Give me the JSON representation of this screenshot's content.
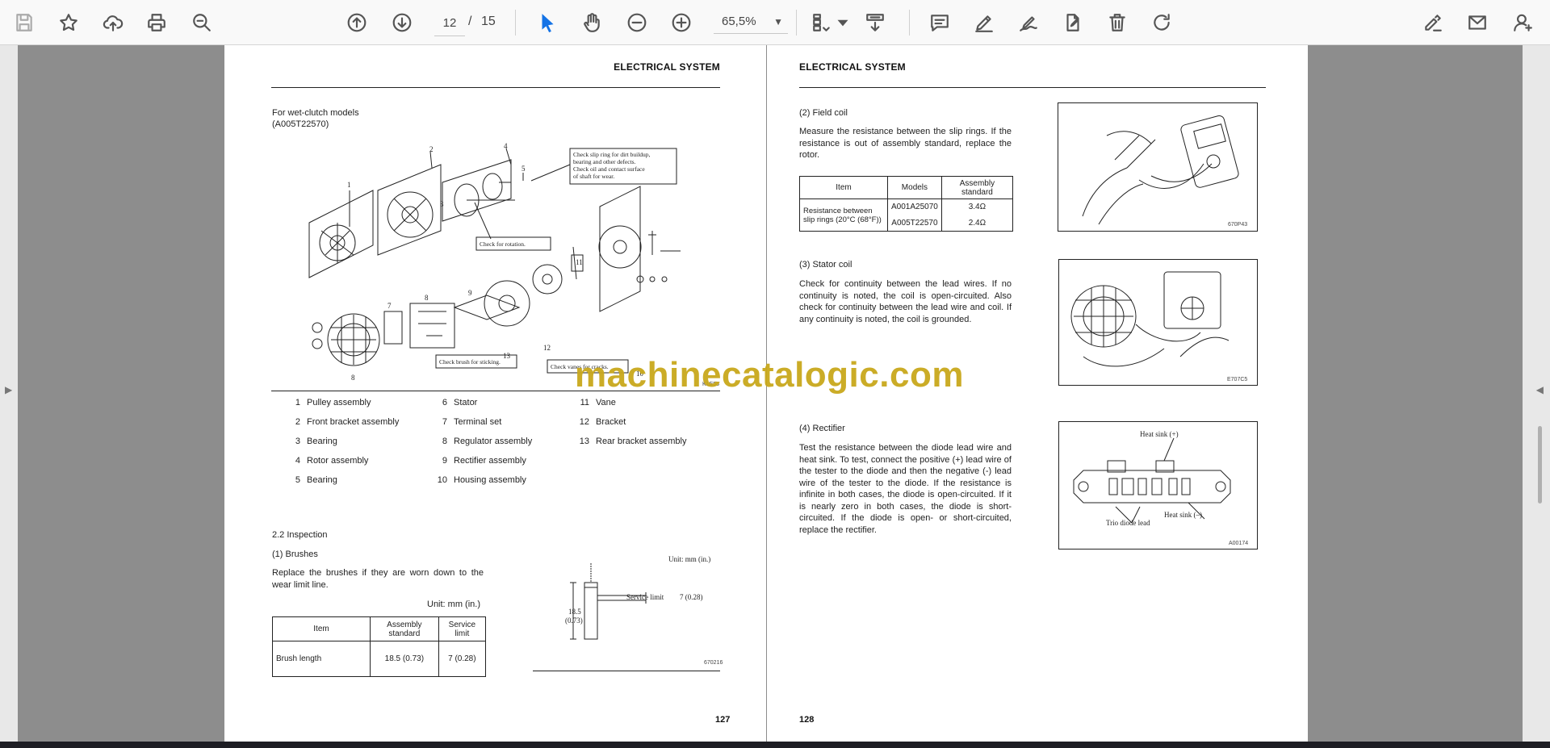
{
  "toolbar": {
    "page_current": "12",
    "page_separator": "/",
    "page_total": "15",
    "zoom": "65,5%",
    "icons": [
      "save-icon",
      "bookmark-star-icon",
      "upload-cloud-icon",
      "print-icon",
      "search-zoom-icon",
      "page-up-icon",
      "page-down-icon",
      "select-cursor-icon",
      "hand-pan-icon",
      "zoom-out-icon",
      "zoom-in-icon",
      "page-layout-icon",
      "scroll-mode-icon",
      "comment-icon",
      "highlight-pen-icon",
      "draw-sign-icon",
      "edit-pdf-icon",
      "delete-icon",
      "rotate-icon",
      "fill-sign-icon",
      "email-icon",
      "add-user-icon"
    ]
  },
  "left_page": {
    "header": "ELECTRICAL SYSTEM",
    "model_line1": "For wet-clutch models",
    "model_line2": "(A005T22570)",
    "diagram_callouts": [
      "Check slip ring for dirt buildup, bearing and other defects. Check oil and contact surface of shaft for wear.",
      "Check for rotation.",
      "Check brush for sticking.",
      "Check vanes for cracks."
    ],
    "diagram_numbers": [
      "1",
      "2",
      "3",
      "4",
      "5",
      "7",
      "8",
      "9",
      "11",
      "12",
      "13",
      "10",
      "8"
    ],
    "diagram_code": "K1E55",
    "parts": [
      {
        "num": "1",
        "name": "Pulley assembly"
      },
      {
        "num": "2",
        "name": "Front bracket assembly"
      },
      {
        "num": "3",
        "name": "Bearing"
      },
      {
        "num": "4",
        "name": "Rotor assembly"
      },
      {
        "num": "5",
        "name": "Bearing"
      },
      {
        "num": "6",
        "name": "Stator"
      },
      {
        "num": "7",
        "name": "Terminal set"
      },
      {
        "num": "8",
        "name": "Regulator assembly"
      },
      {
        "num": "9",
        "name": "Rectifier assembly"
      },
      {
        "num": "10",
        "name": "Housing assembly"
      },
      {
        "num": "11",
        "name": "Vane"
      },
      {
        "num": "12",
        "name": "Bracket"
      },
      {
        "num": "13",
        "name": "Rear bracket assembly"
      }
    ],
    "section": "2.2  Inspection",
    "subsection": "(1)    Brushes",
    "brush_text": "Replace the brushes if they are worn down to the wear limit line.",
    "unit_label": "Unit: mm (in.)",
    "table": {
      "headers": [
        "Item",
        "Assembly standard",
        "Service limit"
      ],
      "row": [
        "Brush length",
        "18.5 (0.73)",
        "7 (0.28)"
      ]
    },
    "brush_fig": {
      "unit": "Unit: mm (in.)",
      "service_limit": "Service limit",
      "service_value": "7 (0.28)",
      "length_value": "18.5",
      "length_in": "(0.73)",
      "code": "670216"
    },
    "page_number": "127"
  },
  "right_page": {
    "header": "ELECTRICAL SYSTEM",
    "field_coil": {
      "title": "(2)    Field coil",
      "text": "Measure the resistance between the slip rings.  If the resistance is out of assembly standard, replace the rotor.",
      "table": {
        "headers": [
          "Item",
          "Models",
          "Assembly standard"
        ],
        "item": "Resistance between slip rings (20°C (68°F))",
        "rows": [
          {
            "model": "A001A25070",
            "value": "3.4Ω"
          },
          {
            "model": "A005T22570",
            "value": "2.4Ω"
          }
        ]
      },
      "fig_code": "670P43"
    },
    "stator_coil": {
      "title": "(3)    Stator coil",
      "text": "Check for continuity between the lead wires.  If no continuity is noted, the coil is open-circuited. Also check for continuity between the lead wire and coil.  If any continuity is noted, the coil is grounded.",
      "fig_code": "E707C5"
    },
    "rectifier": {
      "title": "(4)    Rectifier",
      "text": "Test the resistance between the diode lead wire and heat sink. To test, connect the positive (+) lead wire of the tester to the diode and then the negative (-) lead wire of the tester to the diode. If the resistance is infinite in both cases, the diode is open-circuited.  If it is nearly zero in both cases, the diode is short-circuited.  If the diode is open- or short-circuited, replace the rectifier.",
      "fig_labels": [
        "Heat sink (+)",
        "Heat sink (–)",
        "Trio diode lead"
      ],
      "fig_code": "A00174"
    },
    "page_number": "128"
  },
  "watermark": "machinecatalogic.com"
}
